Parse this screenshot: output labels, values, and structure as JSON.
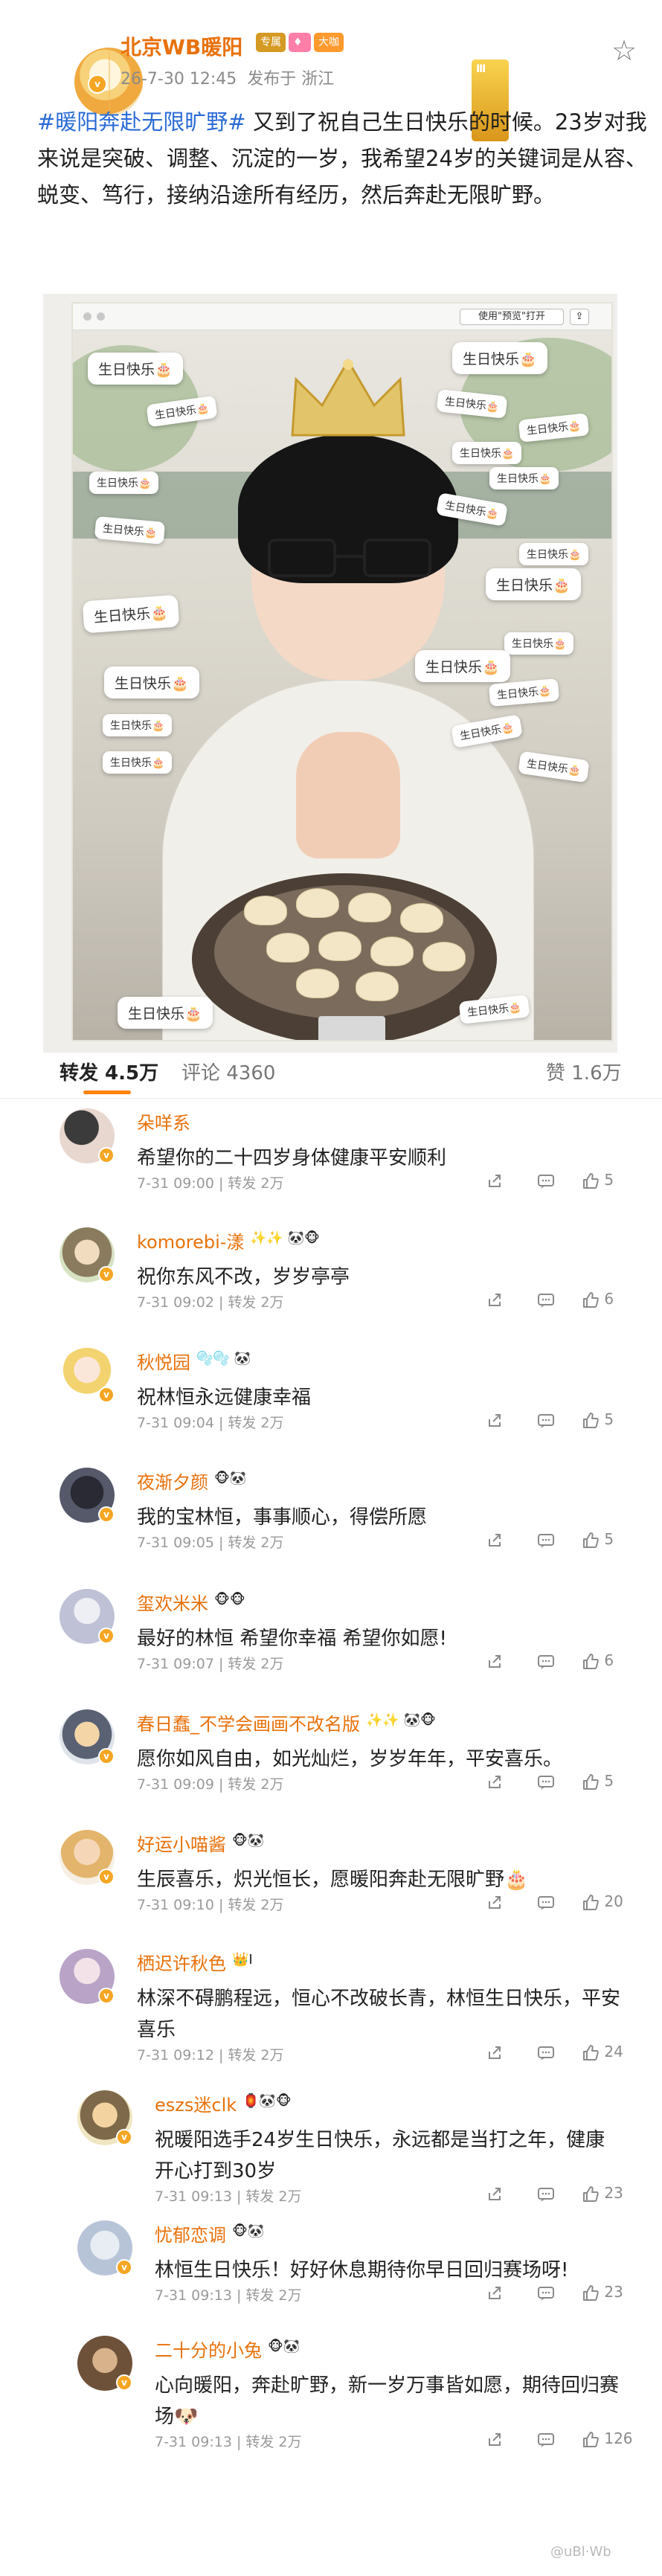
{
  "post": {
    "author": "北京WB暖阳",
    "badges": [
      "Ⅲ",
      "专属",
      "",
      "大咖"
    ],
    "time": "26-7-30 12:45",
    "source": "发布于 浙江",
    "hashtag": "#暖阳奔赴无限旷野#",
    "text": "又到了祝自己生日快乐的时候。23岁对我来说是突破、调整、沉淀的一岁，我希望24岁的关键词是从容、蜕变、笃行，接纳沿途所有经历，然后奔赴无限旷野。"
  },
  "photo": {
    "preview_button": "使用\"预览\"打开",
    "sticker_text": "生日快乐🎂"
  },
  "tabs": {
    "repost": "转发 4.5万",
    "comment": "评论 4360",
    "like": "赞 1.6万"
  },
  "reposts": [
    {
      "name": "朵咩系",
      "badges": "",
      "text": "希望你的二十四岁身体健康平安顺利",
      "meta": "7-31 09:00  |  转发 2万",
      "likes": "5"
    },
    {
      "name": "komorebi-漾",
      "badges": "✨✨ 🐼🐵",
      "text": "祝你东风不改，岁岁亭亭",
      "meta": "7-31 09:02  |  转发 2万",
      "likes": "6"
    },
    {
      "name": "秋悦园",
      "badges": "🫧🫧 🐼",
      "text": "祝林恒永远健康幸福",
      "meta": "7-31 09:04  |  转发 2万",
      "likes": "5"
    },
    {
      "name": "夜渐夕颜",
      "badges": "🐵🐼",
      "text": "我的宝林恒，事事顺心，得偿所愿",
      "meta": "7-31 09:05  |  转发 2万",
      "likes": "5"
    },
    {
      "name": "玺欢米米",
      "badges": "🐵🐵",
      "text": "最好的林恒 希望你幸福 希望你如愿!",
      "meta": "7-31 09:07  |  转发 2万",
      "likes": "6"
    },
    {
      "name": "春日蠢_不学会画画不改名版",
      "badges": "✨✨ 🐼🐵",
      "text": "愿你如风自由，如光灿烂，岁岁年年，平安喜乐。",
      "meta": "7-31 09:09  |  转发 2万",
      "likes": "5"
    },
    {
      "name": "好运小喵酱",
      "badges": "🐵🐼",
      "text": "生辰喜乐，炽光恒长，愿暖阳奔赴无限旷野🎂",
      "meta": "7-31 09:10  |  转发 2万",
      "likes": "20"
    },
    {
      "name": "栖迟许秋色",
      "badges": "👑Ⅰ",
      "text": "林深不碍鹏程远，恒心不改破长青，林恒生日快乐，平安喜乐",
      "meta": "7-31 09:12  |  转发 2万",
      "likes": "24"
    },
    {
      "name": "eszs迷clk",
      "badges": "🏮🐼🐵",
      "text": "祝暖阳选手24岁生日快乐，永远都是当打之年，健康开心打到30岁",
      "meta": "7-31 09:13  |  转发 2万",
      "likes": "23"
    },
    {
      "name": "忧郁恋调",
      "badges": "🐵🐼",
      "text": "林恒生日快乐！好好休息期待你早日回归赛场呀!",
      "meta": "7-31 09:13  |  转发 2万",
      "likes": "23"
    },
    {
      "name": "二十分的小兔",
      "badges": "🐵🐼",
      "text": "心向暖阳，奔赴旷野，新一岁万事皆如愿，期待回归赛场🐶",
      "meta": "7-31 09:13  |  转发 2万",
      "likes": "126"
    }
  ],
  "watermark": "@uBl·Wb",
  "colors": {
    "name": "#e8710b",
    "hashtag": "#2a6bd6",
    "tab_active": "#ff8200",
    "verified": "#f5a623"
  }
}
